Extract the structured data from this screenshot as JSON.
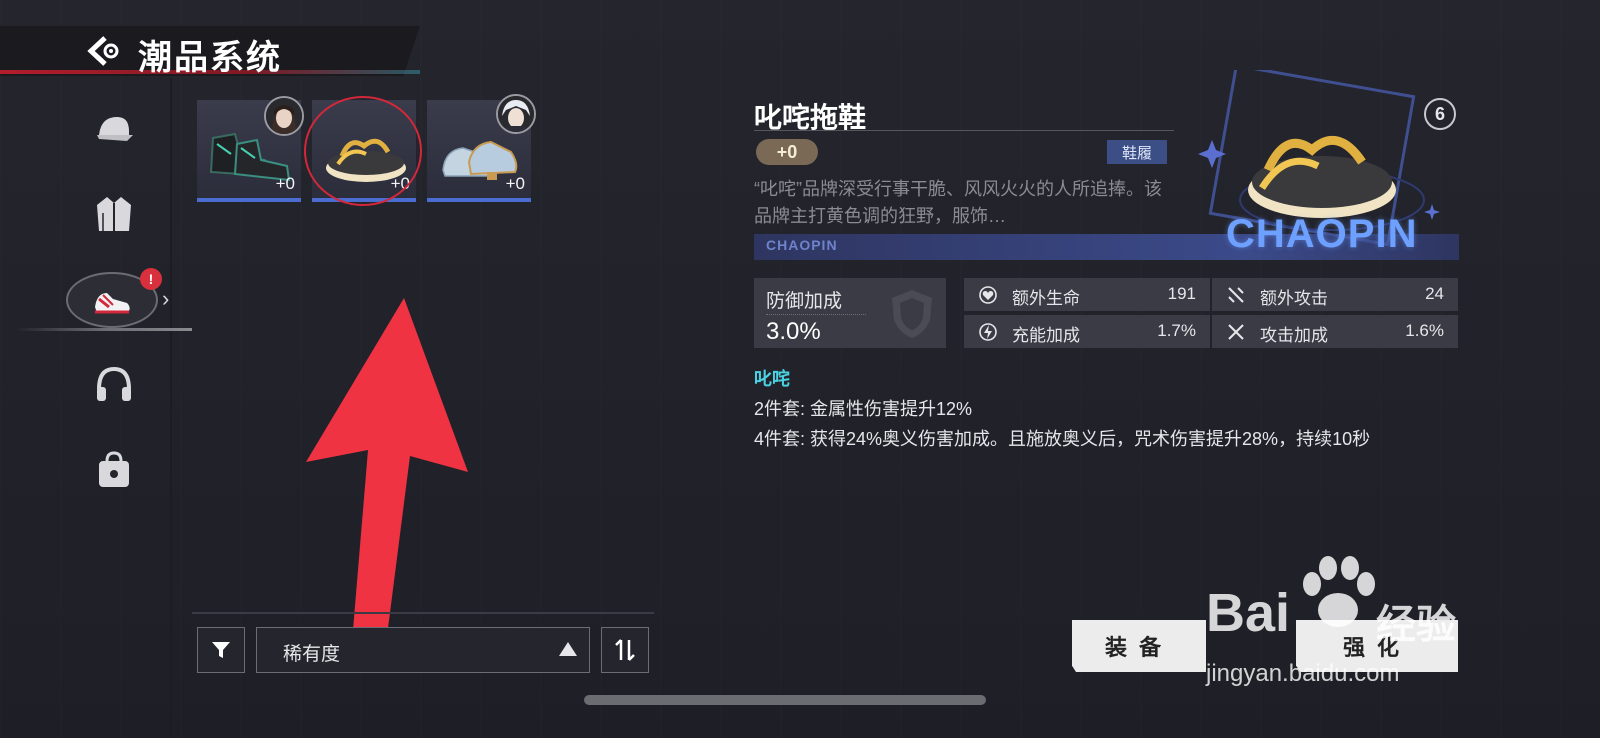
{
  "header": {
    "title": "潮品系统"
  },
  "sidebar": {
    "items": [
      {
        "name": "hat"
      },
      {
        "name": "jacket"
      },
      {
        "name": "shoes",
        "active": true,
        "alert": "!"
      },
      {
        "name": "headphones"
      },
      {
        "name": "bag"
      }
    ]
  },
  "items": [
    {
      "level": "+0"
    },
    {
      "level": "+0"
    },
    {
      "level": "+0"
    }
  ],
  "controls": {
    "sort_label": "稀有度"
  },
  "detail": {
    "title": "叱咤拖鞋",
    "level": "+0",
    "type_tag": "鞋履",
    "description": "“叱咤”品牌深受行事干脆、风风火火的人所追捧。该品牌主打黄色调的狂野，服饰…",
    "strip_text": "CHAOPIN",
    "badge_text": "CHAOPIN",
    "badge_number": "6",
    "main_stat": {
      "name": "防御加成",
      "value": "3.0%"
    },
    "sub_stats": [
      {
        "name": "额外生命",
        "value": "191"
      },
      {
        "name": "额外攻击",
        "value": "24"
      },
      {
        "name": "充能加成",
        "value": "1.7%"
      },
      {
        "name": "攻击加成",
        "value": "1.6%"
      }
    ],
    "set_name": "叱咤",
    "set_bonus_2": "2件套: 金属性伤害提升12%",
    "set_bonus_4": "4件套: 获得24%奥义伤害加成。且施放奥义后，咒术伤害提升28%，持续10秒"
  },
  "actions": {
    "equip_label": "装备",
    "upgrade_label": "强化"
  },
  "watermark": {
    "logo": "Bai",
    "cn": "经验",
    "url": "jingyan.baidu.com"
  },
  "colors": {
    "accent_red": "#d2283a",
    "card_border_blue": "#4b6dd1",
    "set_name_cyan": "#4ad2e2"
  }
}
